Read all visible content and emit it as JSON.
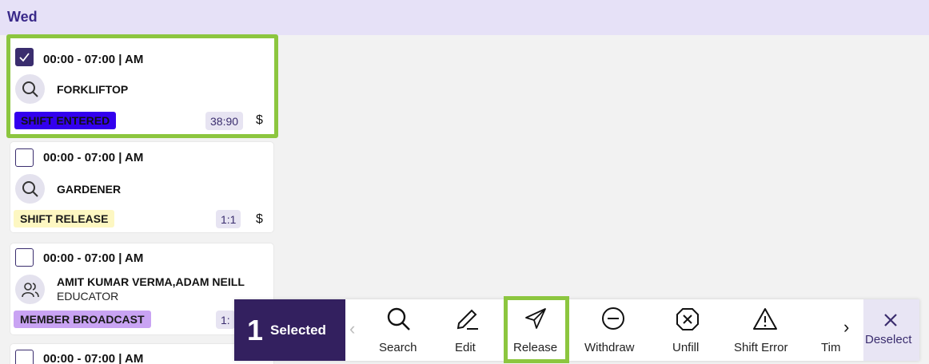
{
  "day": "Wed",
  "shifts": [
    {
      "time": "00:00 - 07:00 | AM",
      "role": "FORKLIFTOP",
      "badge": "SHIFT ENTERED",
      "ratio": "38:90",
      "currency": "$",
      "checked": true
    },
    {
      "time": "00:00 - 07:00 | AM",
      "role": "GARDENER",
      "badge": "SHIFT RELEASE",
      "ratio": "1:1",
      "currency": "$",
      "checked": false
    },
    {
      "time": "00:00 - 07:00 | AM",
      "role": "AMIT KUMAR VERMA,ADAM NEILL",
      "sub": "EDUCATOR",
      "badge": "MEMBER BROADCAST",
      "ratio": "1:",
      "checked": false
    },
    {
      "time": "00:00 - 07:00 | AM",
      "checked": false
    }
  ],
  "toolbar": {
    "count": "1",
    "selected_label": "Selected",
    "actions": [
      "Search",
      "Edit",
      "Release",
      "Withdraw",
      "Unfill",
      "Shift Error",
      "Tim"
    ],
    "deselect_label": "Deselect"
  },
  "colors": {
    "badge_entered": "#3300ee",
    "badge_release": "#fdf7c2",
    "badge_broadcast": "#c9a3f3",
    "highlight": "#8cc63f",
    "accent": "#33205f"
  }
}
